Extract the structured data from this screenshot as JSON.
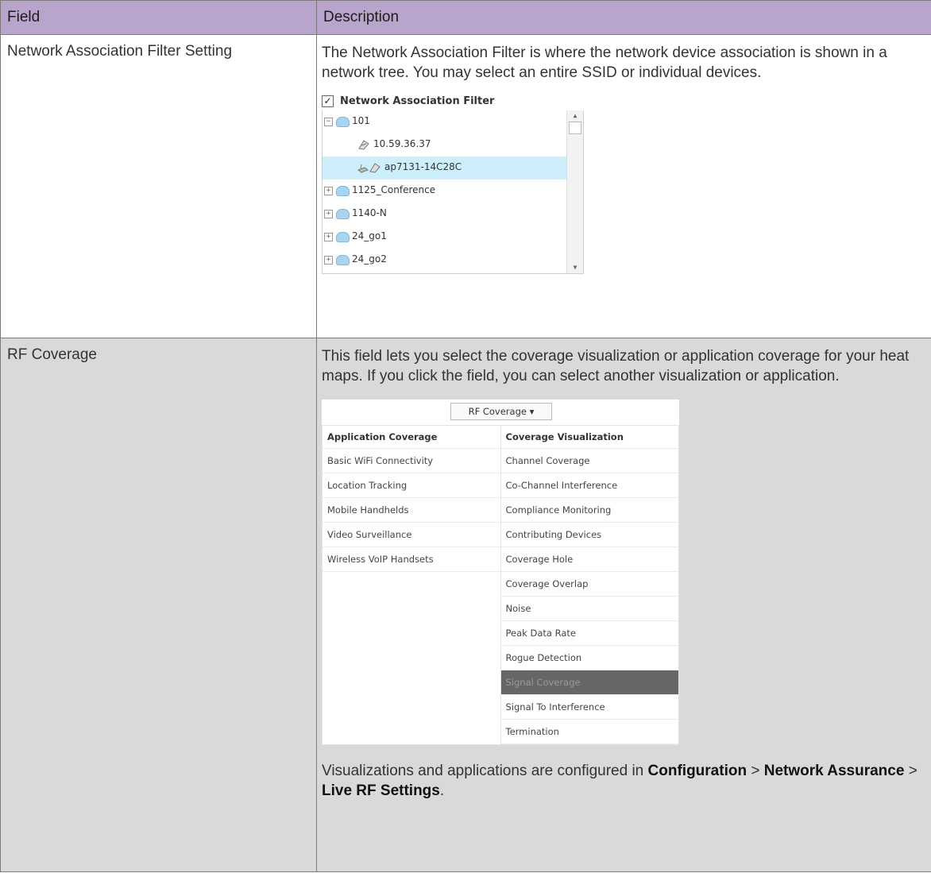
{
  "header": {
    "field": "Field",
    "description": "Description"
  },
  "rows": [
    {
      "field": "Network Association Filter Setting",
      "description": "The Network Association Filter is where the network device association is shown in a network tree. You may select an entire SSID or individual devices.",
      "filter": {
        "checkbox_label": "Network Association Filter",
        "checked_mark": "✓",
        "items": [
          {
            "label": "101",
            "expander": "−",
            "icon": "ssid-cloud-icon"
          },
          {
            "label": "10.59.36.37",
            "icon": "device-icon"
          },
          {
            "label": "ap7131-14C28C",
            "icon": "access-point-icon",
            "selected": true
          },
          {
            "label": "1125_Conference",
            "expander": "+",
            "icon": "ssid-cloud-icon"
          },
          {
            "label": "1140-N",
            "expander": "+",
            "icon": "ssid-cloud-icon"
          },
          {
            "label": "24_go1",
            "expander": "+",
            "icon": "ssid-cloud-icon"
          },
          {
            "label": "24_go2",
            "expander": "+",
            "icon": "ssid-cloud-icon"
          }
        ]
      }
    },
    {
      "field": "RF Coverage",
      "description": "This field lets you select the coverage visualization or application coverage for your heat maps. If you click the field, you can select another visualization or application.",
      "widget": {
        "button_label": "RF Coverage ▾",
        "app_header": "Application Coverage",
        "vis_header": "Coverage Visualization",
        "app_items": [
          "Basic WiFi Connectivity",
          "Location Tracking",
          "Mobile Handhelds",
          "Video Surveillance",
          "Wireless VoIP Handsets"
        ],
        "vis_items": [
          "Channel Coverage",
          "Co-Channel Interference",
          "Compliance Monitoring",
          "Contributing Devices",
          "Coverage Hole",
          "Coverage Overlap",
          "Noise",
          "Peak Data Rate",
          "Rogue Detection",
          "Signal Coverage",
          "Signal To Interference",
          "Termination"
        ],
        "highlighted": "Signal Coverage"
      },
      "note": {
        "prefix": "Visualizations and applications are configured in ",
        "b1": "Configuration",
        "sep1": " > ",
        "b2": "Network Assurance",
        "sep2": " > ",
        "b3": "Live RF Settings",
        "suffix": "."
      }
    }
  ]
}
